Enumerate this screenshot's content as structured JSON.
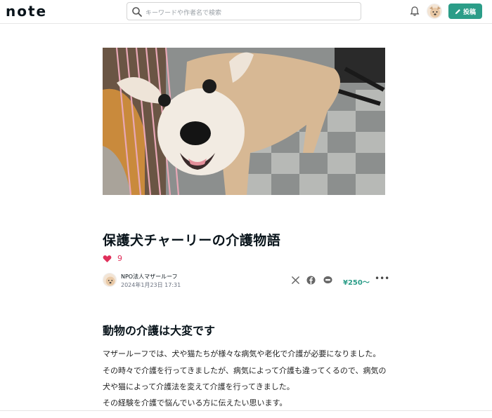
{
  "header": {
    "logo": "note",
    "search_placeholder": "キーワードや作者名で検索",
    "post_label": "投稿",
    "icons": [
      "search-icon",
      "bell-icon",
      "pencil-icon"
    ]
  },
  "article": {
    "title": "保護犬チャーリーの介護物語",
    "like_count": "9",
    "author_name": "NPO法人マザールーフ",
    "date": "2024年1月23日 17:31",
    "price": "¥250〜",
    "more": "•••",
    "heading": "動物の介護は大変です",
    "paragraphs": [
      "マザールーフでは、犬や猫たちが様々な病気や老化で介護が必要になりました。",
      "その時々で介護を行ってきましたが、病気によって介護も違ってくるので、病気の",
      "犬や猫によって介護法を変えて介護を行ってきました。",
      "その経験を介護で悩んでいる方に伝えたい思います。"
    ]
  },
  "colors": {
    "accent": "#2b9d88",
    "like": "#e0305b"
  }
}
